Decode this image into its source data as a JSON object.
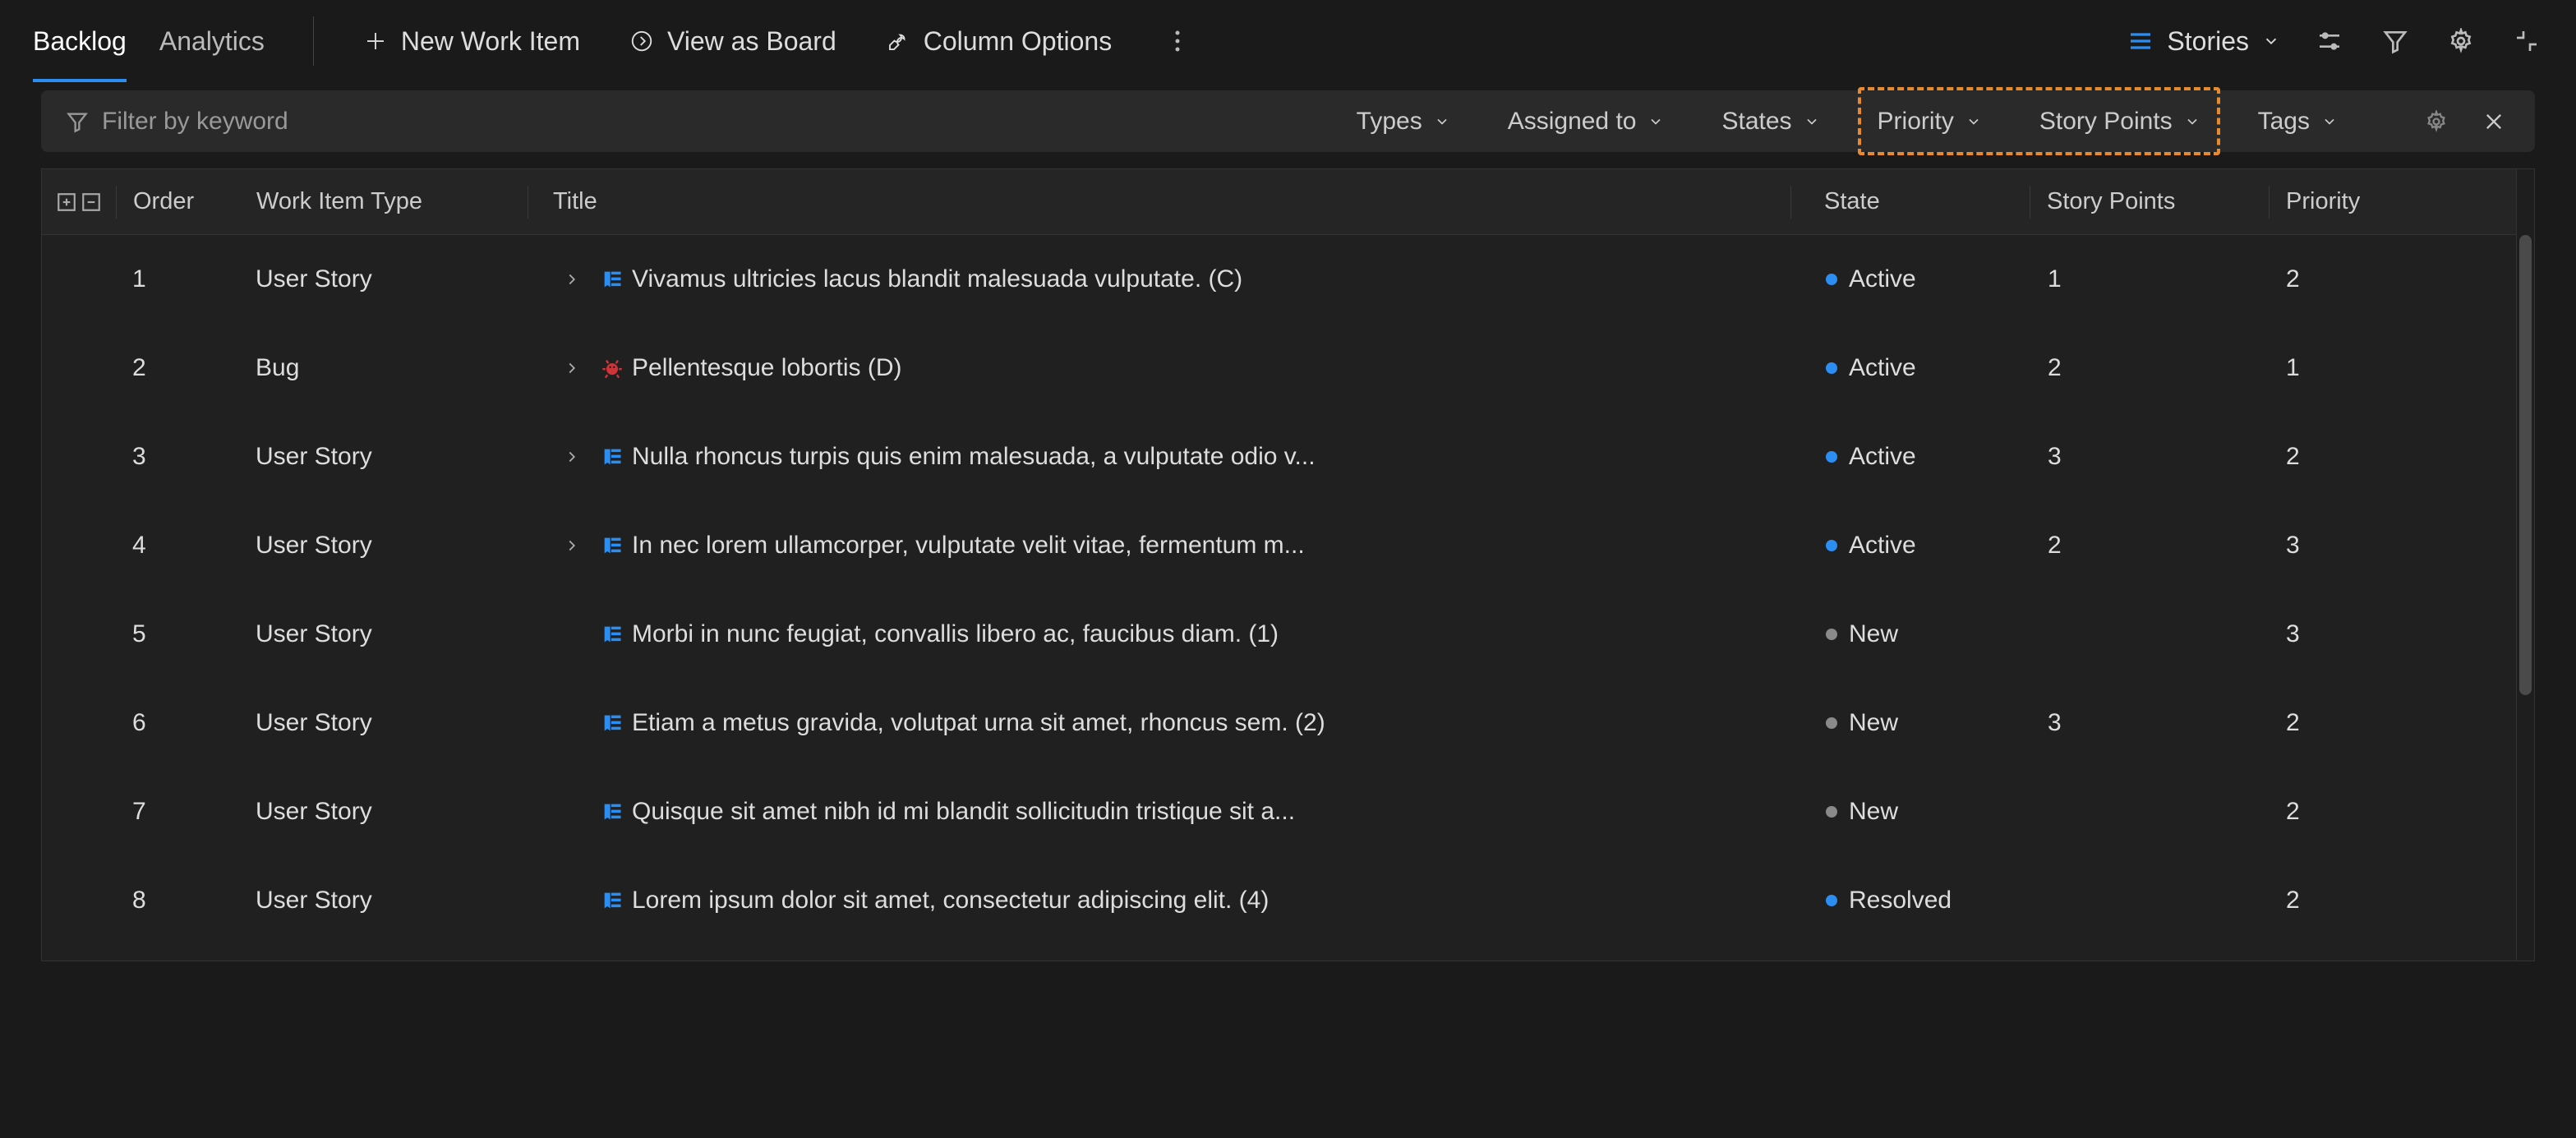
{
  "tabs": {
    "backlog": "Backlog",
    "analytics": "Analytics"
  },
  "toolbar": {
    "new_item": "New Work Item",
    "view_board": "View as Board",
    "column_options": "Column Options",
    "level_selector": "Stories"
  },
  "filter": {
    "placeholder": "Filter by keyword",
    "dropdowns": {
      "types": "Types",
      "assigned_to": "Assigned to",
      "states": "States",
      "priority": "Priority",
      "story_points": "Story Points",
      "tags": "Tags"
    }
  },
  "columns": {
    "order": "Order",
    "type": "Work Item Type",
    "title": "Title",
    "state": "State",
    "points": "Story Points",
    "priority": "Priority"
  },
  "rows": [
    {
      "order": "1",
      "type": "User Story",
      "typeIcon": "story",
      "expandable": true,
      "title": "Vivamus ultricies lacus blandit malesuada vulputate. (C)",
      "state": "Active",
      "stateClass": "active",
      "points": "1",
      "priority": "2"
    },
    {
      "order": "2",
      "type": "Bug",
      "typeIcon": "bug",
      "expandable": true,
      "title": "Pellentesque lobortis (D)",
      "state": "Active",
      "stateClass": "active",
      "points": "2",
      "priority": "1"
    },
    {
      "order": "3",
      "type": "User Story",
      "typeIcon": "story",
      "expandable": true,
      "title": "Nulla rhoncus turpis quis enim malesuada, a vulputate odio v...",
      "state": "Active",
      "stateClass": "active",
      "points": "3",
      "priority": "2"
    },
    {
      "order": "4",
      "type": "User Story",
      "typeIcon": "story",
      "expandable": true,
      "title": "In nec lorem ullamcorper, vulputate velit vitae, fermentum m...",
      "state": "Active",
      "stateClass": "active",
      "points": "2",
      "priority": "3"
    },
    {
      "order": "5",
      "type": "User Story",
      "typeIcon": "story",
      "expandable": false,
      "title": "Morbi in nunc feugiat, convallis libero ac, faucibus diam. (1)",
      "state": "New",
      "stateClass": "new",
      "points": "",
      "priority": "3"
    },
    {
      "order": "6",
      "type": "User Story",
      "typeIcon": "story",
      "expandable": false,
      "title": "Etiam a metus gravida, volutpat urna sit amet, rhoncus sem. (2)",
      "state": "New",
      "stateClass": "new",
      "points": "3",
      "priority": "2"
    },
    {
      "order": "7",
      "type": "User Story",
      "typeIcon": "story",
      "expandable": false,
      "title": "Quisque sit amet nibh id mi blandit sollicitudin tristique sit a...",
      "state": "New",
      "stateClass": "new",
      "points": "",
      "priority": "2"
    },
    {
      "order": "8",
      "type": "User Story",
      "typeIcon": "story",
      "expandable": false,
      "title": "Lorem ipsum dolor sit amet, consectetur adipiscing elit. (4)",
      "state": "Resolved",
      "stateClass": "resolved",
      "points": "",
      "priority": "2"
    }
  ],
  "colors": {
    "accent": "#2c8ef3",
    "highlight": "#e58a2e",
    "bug": "#d13438"
  }
}
